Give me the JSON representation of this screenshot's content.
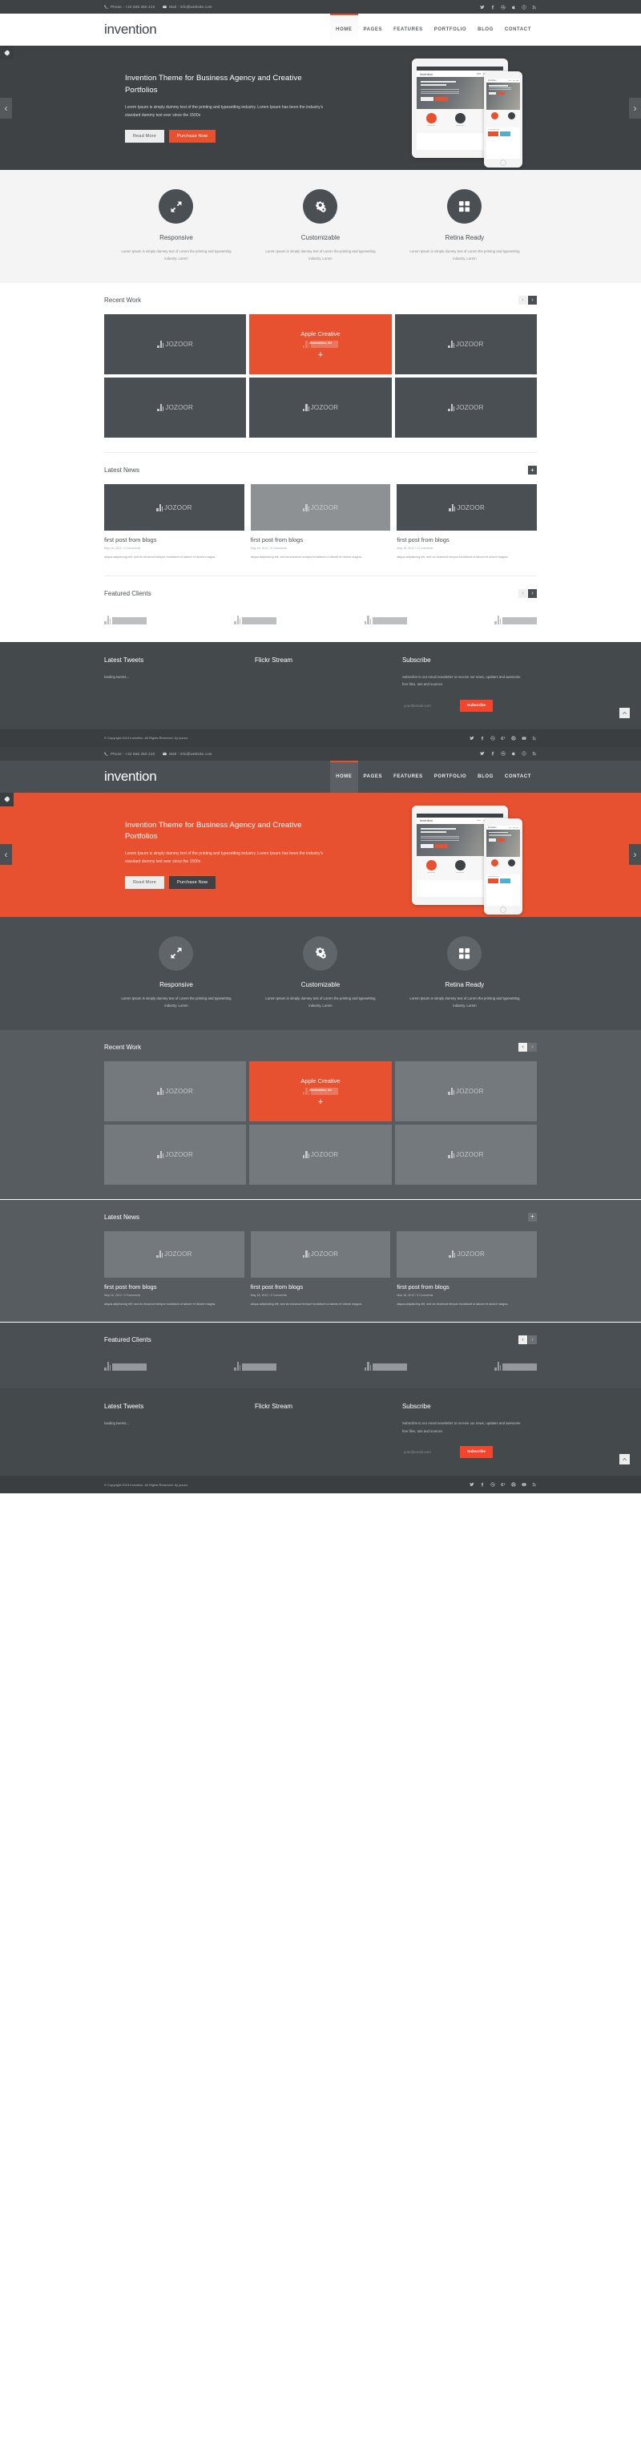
{
  "topbar": {
    "phone": "Phone : +22 665 450 210",
    "mail": "Mail : info@website.com",
    "social": [
      "twitter-icon",
      "facebook-icon",
      "dribbble-icon",
      "apple-icon",
      "skype-icon",
      "rss-icon"
    ]
  },
  "brand": {
    "logo": "invention"
  },
  "nav": {
    "items": [
      {
        "label": "HOME",
        "active": true
      },
      {
        "label": "PAGES",
        "active": false
      },
      {
        "label": "FEATURES",
        "active": false
      },
      {
        "label": "PORTFOLIO",
        "active": false
      },
      {
        "label": "BLOG",
        "active": false
      },
      {
        "label": "CONTACT",
        "active": false
      }
    ]
  },
  "hero": {
    "title": "Invention Theme for Business Agency and Creative Portfolios",
    "subtitle": "Lorem Ipsum is simply dummy text of the printing and typesetting industry. Lorem Ipsum has been the industry's standard dummy text ever since the 1500s",
    "btn_primary": "Read More",
    "btn_secondary": "Purchase Now",
    "prev": "‹",
    "next": "›",
    "settings_icon": "gear-icon"
  },
  "features": {
    "items": [
      {
        "title": "Responsive",
        "desc": "Lorem Ipsum is simply dummy text of Lorem the printing and typesetting industry. Lorem",
        "icon": "expand-arrows-icon"
      },
      {
        "title": "Customizable",
        "desc": "Lorem Ipsum is simply dummy text of Lorem the printing and typesetting industry. Lorem",
        "icon": "gears-icon"
      },
      {
        "title": "Retina Ready",
        "desc": "Lorem Ipsum is simply dummy text of Lorem the printing and typesetting industry. Lorem",
        "icon": "grid-icon"
      }
    ]
  },
  "recent_work": {
    "title": "Recent Work",
    "prev": "‹",
    "next": "›",
    "featured": {
      "name": "Apple Creative",
      "category": "Illustration, 3d",
      "plus": "+"
    },
    "logo_text": "JOZOOR",
    "cells": 6
  },
  "latest_news": {
    "title": "Latest News",
    "plus": "+",
    "logo_text": "JOZOOR",
    "posts": [
      {
        "title": "first post from blogs",
        "meta": "May 18, 2012 / 3 Comments",
        "excerpt": "aliqua.adipisicing elit, sed do eiusmod tempor incididunt ut labore et dolore magna.."
      },
      {
        "title": "first post from blogs",
        "meta": "May 18, 2012 / 3 Comments",
        "excerpt": "aliqua.adipisicing elit, sed do eiusmod tempor incididunt ut labore et dolore magna.."
      },
      {
        "title": "first post from blogs",
        "meta": "May 18, 2012 / 3 Comments",
        "excerpt": "aliqua.adipisicing elit, sed do eiusmod tempor incididunt ut labore et dolore magna.."
      }
    ]
  },
  "featured_clients": {
    "title": "Featured Clients",
    "prev": "‹",
    "next": "›",
    "logos": [
      "JOZOOR",
      "JOZOOR",
      "JOZOOR",
      "JOZOOR"
    ]
  },
  "footer": {
    "tweets_title": "Latest Tweets",
    "tweets_body": "loading tweets...",
    "flickr_title": "Flickr Stream",
    "subscribe_title": "Subscribe",
    "subscribe_body": "Subscribe to our email newsletter to receive our news, updates and awesome free files, tuts and sources",
    "email_placeholder": "your@email.com",
    "email_value": "",
    "subscribe_button": "Subscribe",
    "to_top_icon": "chevron-up-icon",
    "copyright": "© Copyright 2013 Invention. All Rights Reserved. by jozoor",
    "social": [
      "twitter-icon",
      "facebook-icon",
      "dribbble-icon",
      "google-plus-icon",
      "pinterest-icon",
      "youtube-icon",
      "rss-icon"
    ]
  },
  "colors": {
    "accent": "#e8512f",
    "dark": "#3e4245",
    "nav_dark": "#4a4f53",
    "section_dark": "#575c60",
    "light_bg": "#f4f4f4",
    "subscribe_red": "#f4442c"
  }
}
